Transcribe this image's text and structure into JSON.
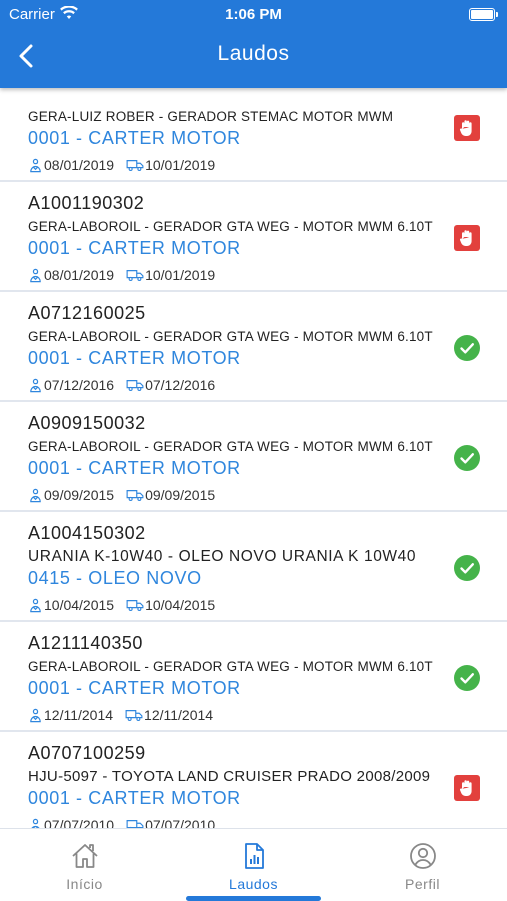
{
  "status_bar": {
    "carrier": "Carrier",
    "time": "1:06 PM"
  },
  "header": {
    "title": "Laudos"
  },
  "laudos": [
    {
      "code": "",
      "desc": "GERA-LUIZ ROBER - GERADOR STEMAC MOTOR MWM",
      "item": "0001 - CARTER MOTOR",
      "date1": "08/01/2019",
      "date2": "10/01/2019",
      "status": "alert"
    },
    {
      "code": "A1001190302",
      "desc": "GERA-LABOROIL - GERADOR GTA WEG - MOTOR MWM 6.10T",
      "item": "0001 - CARTER MOTOR",
      "date1": "08/01/2019",
      "date2": "10/01/2019",
      "status": "alert"
    },
    {
      "code": "A0712160025",
      "desc": "GERA-LABOROIL - GERADOR GTA WEG - MOTOR MWM 6.10T",
      "item": "0001 - CARTER MOTOR",
      "date1": "07/12/2016",
      "date2": "07/12/2016",
      "status": "ok"
    },
    {
      "code": "A0909150032",
      "desc": "GERA-LABOROIL - GERADOR GTA WEG - MOTOR MWM 6.10T",
      "item": "0001 - CARTER MOTOR",
      "date1": "09/09/2015",
      "date2": "09/09/2015",
      "status": "ok"
    },
    {
      "code": "A1004150302",
      "desc": "URANIA K-10W40 - OLEO NOVO URANIA K 10W40",
      "item": "0415 - OLEO NOVO",
      "date1": "10/04/2015",
      "date2": "10/04/2015",
      "status": "ok"
    },
    {
      "code": "A1211140350",
      "desc": "GERA-LABOROIL - GERADOR GTA WEG - MOTOR MWM 6.10T",
      "item": "0001 - CARTER MOTOR",
      "date1": "12/11/2014",
      "date2": "12/11/2014",
      "status": "ok"
    },
    {
      "code": "A0707100259",
      "desc": "HJU-5097 - TOYOTA LAND CRUISER PRADO 2008/2009",
      "item": "0001 - CARTER MOTOR",
      "date1": "07/07/2010",
      "date2": "07/07/2010",
      "status": "alert"
    }
  ],
  "tabs": [
    {
      "label": "Início",
      "icon": "home-icon",
      "active": false
    },
    {
      "label": "Laudos",
      "icon": "report-icon",
      "active": true
    },
    {
      "label": "Perfil",
      "icon": "profile-icon",
      "active": false
    }
  ],
  "colors": {
    "accent": "#2479d9",
    "ok": "#45b34a",
    "alert": "#e2403d",
    "link": "#2f86dd"
  }
}
